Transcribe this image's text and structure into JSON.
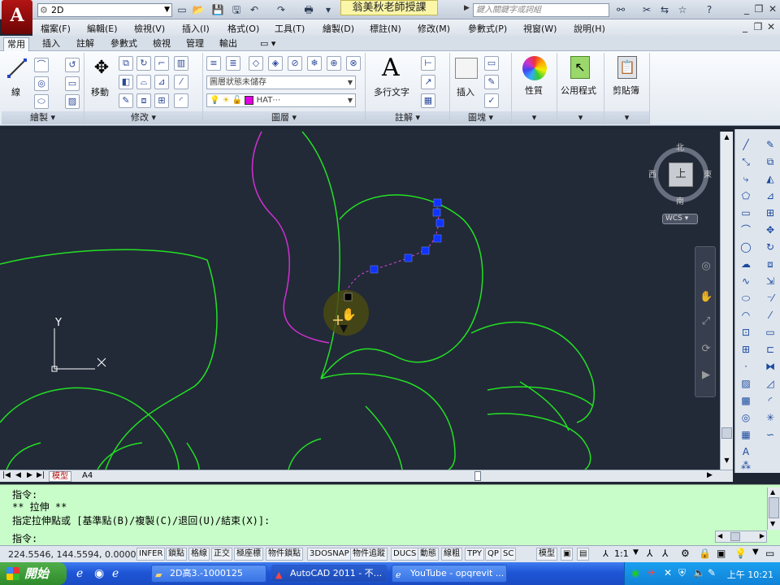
{
  "title_bar": {
    "workspace": "2D",
    "title": "翁美秋老師授課",
    "search_placeholder": "鍵入關鍵字或詞組"
  },
  "menu": [
    "檔案(F)",
    "編輯(E)",
    "檢視(V)",
    "插入(I)",
    "格式(O)",
    "工具(T)",
    "繪製(D)",
    "標註(N)",
    "修改(M)",
    "參數式(P)",
    "視窗(W)",
    "說明(H)"
  ],
  "ribbon_tabs": [
    "常用",
    "插入",
    "註解",
    "參數式",
    "檢視",
    "管理",
    "輸出"
  ],
  "ribbon": {
    "draw_panel": "繪製",
    "modify_panel": "修改",
    "layers_panel": "圖層",
    "annotation_panel": "註解",
    "block_panel": "圖塊",
    "line_label": "線",
    "move_label": "移動",
    "layer_state": "圖層狀態未儲存",
    "layer_current": "HAT⋯",
    "mtext_label": "多行文字",
    "insert_label": "插入",
    "properties_label": "性質",
    "utilities_label": "公用程式",
    "clipboard_label": "剪貼簿"
  },
  "viewcube": {
    "north": "北",
    "south": "南",
    "west": "西",
    "east": "東",
    "top": "上",
    "wcs": "WCS"
  },
  "ucs": {
    "x": "X",
    "y": "Y"
  },
  "layout_tabs": [
    "模型",
    "A4"
  ],
  "command": {
    "line1": "指令:",
    "line2": "** 拉伸 **",
    "line3": "指定拉伸點或 [基準點(B)/複製(C)/退回(U)/結束(X)]:",
    "prompt": "指令:"
  },
  "status": {
    "coords": "224.5546, 144.5594, 0.0000",
    "toggles": [
      "INFER",
      "鎖點",
      "格線",
      "正交",
      "極座標",
      "物件鎖點",
      "3DOSNAP",
      "物件追蹤",
      "DUCS",
      "動態",
      "線粗",
      "TPY",
      "QP",
      "SC"
    ],
    "model": "模型",
    "scale": "1:1"
  },
  "taskbar": {
    "start": "開始",
    "items": [
      "2D高3.-1000125",
      "AutoCAD 2011 - 不...",
      "YouTube - opqrevit ..."
    ],
    "clock": "上午 10:21"
  },
  "colors": {
    "canvas_bg": "#222a38",
    "petal_green": "#22e022",
    "magenta_polyline": "#d030d0",
    "grip_blue": "#1133ff",
    "command_bg": "#c8fcc8"
  }
}
